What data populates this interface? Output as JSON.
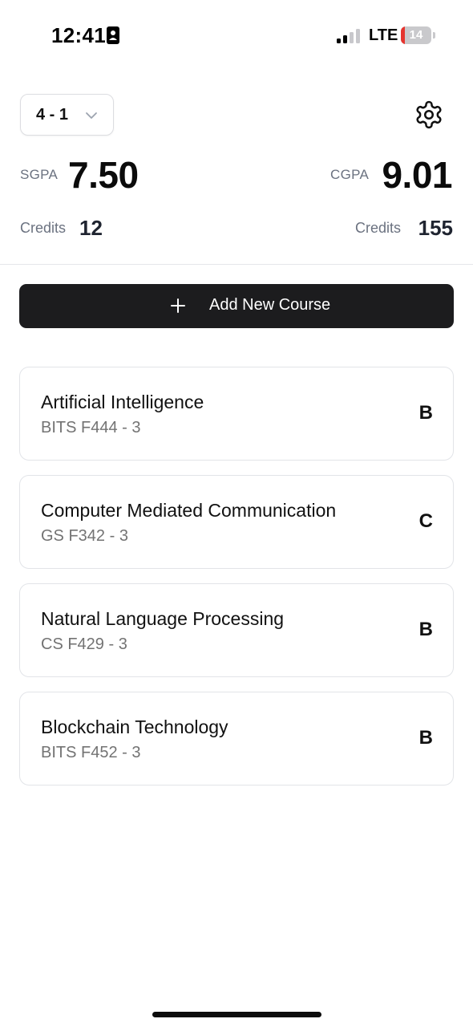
{
  "status_bar": {
    "time": "12:41",
    "network": "LTE",
    "battery_level": "14",
    "battery_fraction": 0.14,
    "signal_bars_active": 2,
    "signal_bars_total": 4
  },
  "header": {
    "semester": "4 - 1",
    "sgpa_label": "SGPA",
    "sgpa_value": "7.50",
    "cgpa_label": "CGPA",
    "cgpa_value": "9.01",
    "sgpa_credits_label": "Credits",
    "sgpa_credits_value": "12",
    "cgpa_credits_label": "Credits",
    "cgpa_credits_value": "155"
  },
  "actions": {
    "add_course_label": "Add New Course"
  },
  "courses": [
    {
      "name": "Artificial Intelligence",
      "meta": "BITS F444 - 3",
      "grade": "B"
    },
    {
      "name": "Computer Mediated Communication",
      "meta": "GS F342 - 3",
      "grade": "C"
    },
    {
      "name": "Natural Language Processing",
      "meta": "CS F429 - 3",
      "grade": "B"
    },
    {
      "name": "Blockchain Technology",
      "meta": "BITS F452 - 3",
      "grade": "B"
    }
  ],
  "icons": {
    "contact": "person-card-icon",
    "signal": "cellular-signal-icon",
    "battery": "battery-icon",
    "chevron": "chevron-down-icon",
    "settings": "gear-icon",
    "add": "plus-icon"
  },
  "colors": {
    "primary_button": "#1c1c1e",
    "battery_low": "#e5352f",
    "muted_text": "#6b7280"
  }
}
